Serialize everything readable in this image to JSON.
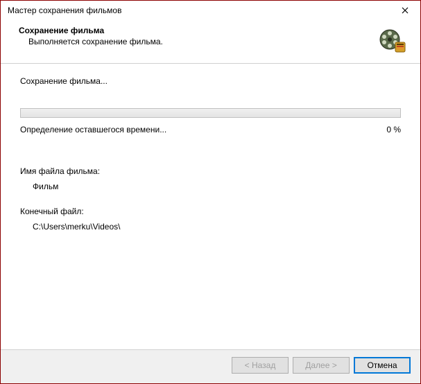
{
  "window": {
    "title": "Мастер сохранения фильмов"
  },
  "header": {
    "title": "Сохранение фильма",
    "subtitle": "Выполняется сохранение фильма."
  },
  "progress": {
    "section_label": "Сохранение фильма...",
    "status_text": "Определение оставшегося времени...",
    "percent_text": "0 %"
  },
  "fields": {
    "filename_label": "Имя файла фильма:",
    "filename_value": "Фильм",
    "destination_label": "Конечный файл:",
    "destination_value": "C:\\Users\\merku\\Videos\\"
  },
  "buttons": {
    "back": "< Назад",
    "next": "Далее >",
    "cancel": "Отмена"
  }
}
